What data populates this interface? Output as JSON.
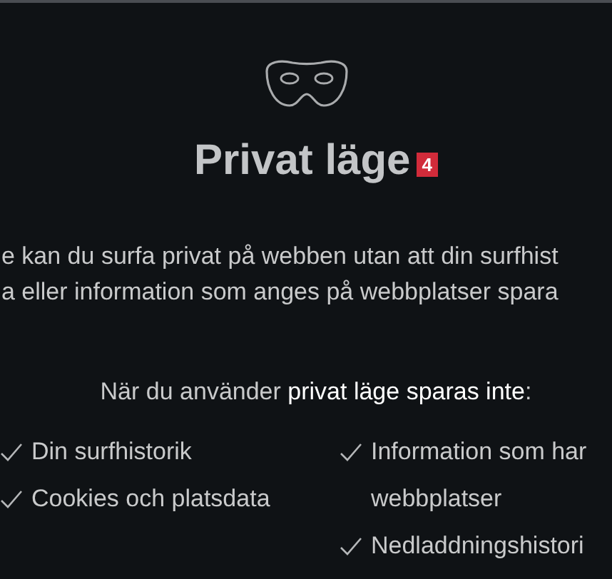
{
  "title": "Privat läge",
  "badge": "4",
  "description_lines": [
    "e kan du surfa privat på webben utan att din surfhist",
    "a eller information som anges på webbplatser spara"
  ],
  "not_saved_heading": "När du använder **privat läge sparas inte**:",
  "columns": [
    [
      {
        "lines": [
          "Din surfhistorik"
        ]
      },
      {
        "lines": [
          "Cookies och platsdata"
        ]
      }
    ],
    [
      {
        "lines": [
          "Information som har",
          "webbplatser"
        ]
      },
      {
        "lines": [
          "Nedladdningshistori"
        ]
      }
    ]
  ]
}
